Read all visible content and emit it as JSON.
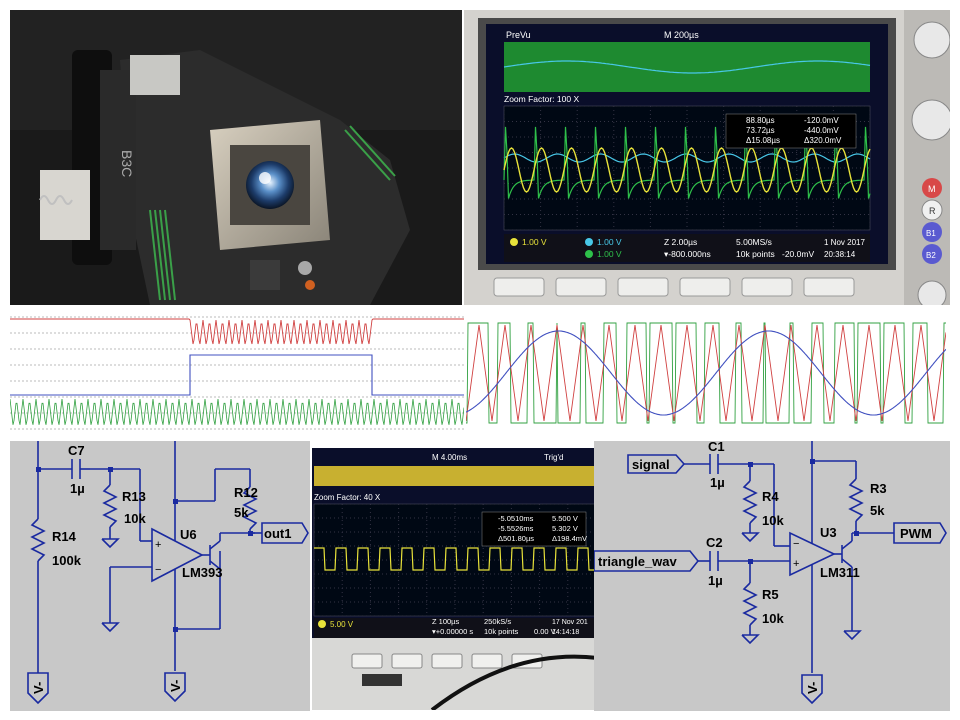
{
  "photo": {
    "pickup_label": "B3C"
  },
  "scope1": {
    "prevu": "PreVu",
    "timebase": "M 200µs",
    "zoom": "Zoom Factor: 100 X",
    "cur_a": "88.80µs",
    "cur_b": "73.72µs",
    "cur_d": "Δ15.08µs",
    "v_a": "-120.0mV",
    "v_b": "-440.0mV",
    "v_d": "Δ320.0mV",
    "ch1": "1.00 V",
    "ch2": "1.00 V",
    "ch3": "1.00 V",
    "zoom_time": "Z 2.00µs",
    "offset": "▾-800.000ns",
    "rate": "5.00MS/s",
    "points": "10k points",
    "trig": "-20.0mV",
    "date": "1 Nov 2017",
    "time": "20:38:14",
    "side_m": "M",
    "side_r": "R",
    "side_b1": "B1",
    "side_b2": "B2"
  },
  "scope2": {
    "timebase": "M 4.00ms",
    "trigd": "Trig'd",
    "zoom": "Zoom Factor: 40 X",
    "cur_a": "-5.0510ms",
    "cur_b": "-5.5526ms",
    "cur_d": "Δ501.80µs",
    "v_a": "5.500 V",
    "v_b": "5.302 V",
    "v_d": "Δ198.4mV",
    "ch1": "5.00 V",
    "zoom_time": "Z 100µs",
    "offset": "▾+0.00000 s",
    "rate": "250kS/s",
    "points": "10k points",
    "trig": "0.00 V",
    "date": "17 Nov 201",
    "time": "14:14:18"
  },
  "schematic1": {
    "c7": "C7",
    "c7_val": "1µ",
    "r13": "R13",
    "r13_val": "10k",
    "r14": "R14",
    "r14_val": "100k",
    "r12": "R12",
    "r12_val": "5k",
    "u6": "U6",
    "u6_part": "LM393",
    "out": "out1",
    "vneg1": "V-",
    "vneg2": "V-"
  },
  "schematic2": {
    "signal": "signal",
    "triangle": "triangle_wav",
    "pwm": "PWM",
    "c1": "C1",
    "c1_val": "1µ",
    "c2": "C2",
    "c2_val": "1µ",
    "r4": "R4",
    "r4_val": "10k",
    "r5": "R5",
    "r5_val": "10k",
    "r3": "R3",
    "r3_val": "5k",
    "u3": "U3",
    "u3_part": "LM311",
    "vneg": "V-"
  },
  "colors": {
    "scope_yellow": "#e8e23a",
    "scope_cyan": "#48c8e8",
    "scope_green": "#2ec04a",
    "sim_red": "#d04040",
    "sim_green": "#30a040",
    "sim_blue": "#4050c0",
    "schematic_blue": "#1a2aa0",
    "schematic_bg": "#c8c8c8"
  }
}
